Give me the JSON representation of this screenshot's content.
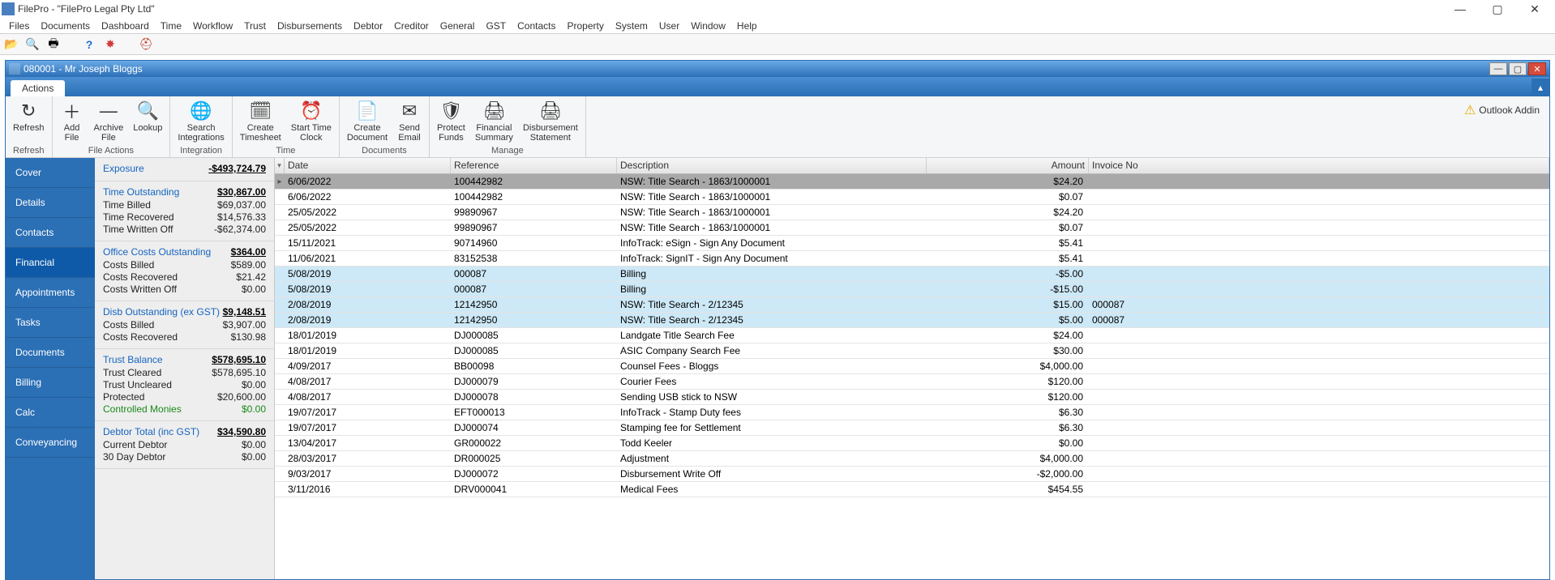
{
  "app": {
    "title": "FilePro - \"FilePro Legal Pty Ltd\""
  },
  "menu": [
    "Files",
    "Documents",
    "Dashboard",
    "Time",
    "Workflow",
    "Trust",
    "Disbursements",
    "Debtor",
    "Creditor",
    "General",
    "GST",
    "Contacts",
    "Property",
    "System",
    "User",
    "Window",
    "Help"
  ],
  "child": {
    "title": "080001 - Mr Joseph Bloggs"
  },
  "tab": {
    "label": "Actions"
  },
  "ribbon": {
    "groups": [
      {
        "label": "Refresh",
        "items": [
          {
            "icon": "↻",
            "label": "Refresh",
            "name": "refresh"
          }
        ]
      },
      {
        "label": "File Actions",
        "items": [
          {
            "icon": "＋",
            "label": "Add\nFile",
            "name": "add-file"
          },
          {
            "icon": "—",
            "label": "Archive\nFile",
            "name": "archive-file"
          },
          {
            "icon": "🔍",
            "label": "Lookup",
            "name": "lookup"
          }
        ]
      },
      {
        "label": "Integration",
        "items": [
          {
            "icon": "🌐",
            "label": "Search\nIntegrations",
            "name": "search-integrations"
          }
        ]
      },
      {
        "label": "Time",
        "items": [
          {
            "icon": "🗓",
            "label": "Create\nTimesheet",
            "name": "create-timesheet"
          },
          {
            "icon": "⏰",
            "label": "Start Time\nClock",
            "name": "start-time-clock"
          }
        ]
      },
      {
        "label": "Documents",
        "items": [
          {
            "icon": "📄",
            "label": "Create\nDocument",
            "name": "create-document"
          },
          {
            "icon": "✉",
            "label": "Send\nEmail",
            "name": "send-email"
          }
        ]
      },
      {
        "label": "Manage",
        "items": [
          {
            "icon": "🛡",
            "label": "Protect\nFunds",
            "name": "protect-funds"
          },
          {
            "icon": "🖨",
            "label": "Financial\nSummary",
            "name": "financial-summary"
          },
          {
            "icon": "🖨",
            "label": "Disbursement\nStatement",
            "name": "disbursement-statement"
          }
        ]
      }
    ],
    "outlook_addin": "Outlook Addin"
  },
  "sidenav": [
    "Cover",
    "Details",
    "Contacts",
    "Financial",
    "Appointments",
    "Tasks",
    "Documents",
    "Billing",
    "Calc",
    "Conveyancing"
  ],
  "sidenav_active": 3,
  "summary": [
    {
      "head": "Exposure",
      "headval": "-$493,724.79",
      "rows": []
    },
    {
      "head": "Time Outstanding",
      "headval": "$30,867.00",
      "rows": [
        {
          "l": "Time Billed",
          "v": "$69,037.00"
        },
        {
          "l": "Time Recovered",
          "v": "$14,576.33"
        },
        {
          "l": "Time Written Off",
          "v": "-$62,374.00"
        }
      ]
    },
    {
      "head": "Office Costs Outstanding",
      "headval": "$364.00",
      "rows": [
        {
          "l": "Costs Billed",
          "v": "$589.00"
        },
        {
          "l": "Costs Recovered",
          "v": "$21.42"
        },
        {
          "l": "Costs Written Off",
          "v": "$0.00"
        }
      ]
    },
    {
      "head": "Disb Outstanding (ex GST)",
      "headval": "$9,148.51",
      "rows": [
        {
          "l": "Costs Billed",
          "v": "$3,907.00"
        },
        {
          "l": "Costs Recovered",
          "v": "$130.98"
        }
      ]
    },
    {
      "head": "Trust Balance",
      "headval": "$578,695.10",
      "rows": [
        {
          "l": "Trust Cleared",
          "v": "$578,695.10"
        },
        {
          "l": "Trust Uncleared",
          "v": "$0.00"
        },
        {
          "l": "Protected",
          "v": "$20,600.00"
        },
        {
          "l": "Controlled Monies",
          "v": "$0.00",
          "green": true
        }
      ]
    },
    {
      "head": "Debtor Total (inc GST)",
      "headval": "$34,590.80",
      "rows": [
        {
          "l": "Current Debtor",
          "v": "$0.00"
        },
        {
          "l": "30 Day Debtor",
          "v": "$0.00"
        }
      ]
    }
  ],
  "grid": {
    "columns": [
      "Date",
      "Reference",
      "Description",
      "Amount",
      "Invoice No"
    ],
    "rows": [
      {
        "sel": true,
        "d": "6/06/2022",
        "r": "100442982",
        "desc": "NSW: Title Search - 1863/1000001",
        "a": "$24.20",
        "i": ""
      },
      {
        "d": "6/06/2022",
        "r": "100442982",
        "desc": "NSW: Title Search - 1863/1000001",
        "a": "$0.07",
        "i": ""
      },
      {
        "d": "25/05/2022",
        "r": "99890967",
        "desc": "NSW: Title Search - 1863/1000001",
        "a": "$24.20",
        "i": ""
      },
      {
        "d": "25/05/2022",
        "r": "99890967",
        "desc": "NSW: Title Search - 1863/1000001",
        "a": "$0.07",
        "i": ""
      },
      {
        "d": "15/11/2021",
        "r": "90714960",
        "desc": "InfoTrack: eSign - Sign Any Document",
        "a": "$5.41",
        "i": ""
      },
      {
        "d": "11/06/2021",
        "r": "83152538",
        "desc": "InfoTrack: SignIT - Sign Any Document",
        "a": "$5.41",
        "i": ""
      },
      {
        "blue": true,
        "d": "5/08/2019",
        "r": "000087",
        "desc": "Billing",
        "a": "-$5.00",
        "i": ""
      },
      {
        "blue": true,
        "d": "5/08/2019",
        "r": "000087",
        "desc": "Billing",
        "a": "-$15.00",
        "i": ""
      },
      {
        "blue": true,
        "d": "2/08/2019",
        "r": "12142950",
        "desc": "NSW: Title Search - 2/12345",
        "a": "$15.00",
        "i": "000087"
      },
      {
        "blue": true,
        "d": "2/08/2019",
        "r": "12142950",
        "desc": "NSW: Title Search - 2/12345",
        "a": "$5.00",
        "i": "000087"
      },
      {
        "d": "18/01/2019",
        "r": "DJ000085",
        "desc": "Landgate Title Search Fee",
        "a": "$24.00",
        "i": ""
      },
      {
        "d": "18/01/2019",
        "r": "DJ000085",
        "desc": "ASIC Company Search Fee",
        "a": "$30.00",
        "i": ""
      },
      {
        "d": "4/09/2017",
        "r": "BB00098",
        "desc": "Counsel Fees - Bloggs",
        "a": "$4,000.00",
        "i": ""
      },
      {
        "d": "4/08/2017",
        "r": "DJ000079",
        "desc": "Courier Fees",
        "a": "$120.00",
        "i": ""
      },
      {
        "d": "4/08/2017",
        "r": "DJ000078",
        "desc": "Sending USB stick to NSW",
        "a": "$120.00",
        "i": ""
      },
      {
        "d": "19/07/2017",
        "r": "EFT000013",
        "desc": "InfoTrack - Stamp Duty fees",
        "a": "$6.30",
        "i": ""
      },
      {
        "d": "19/07/2017",
        "r": "DJ000074",
        "desc": "Stamping fee for Settlement",
        "a": "$6.30",
        "i": ""
      },
      {
        "d": "13/04/2017",
        "r": "GR000022",
        "desc": "Todd Keeler",
        "a": "$0.00",
        "i": ""
      },
      {
        "d": "28/03/2017",
        "r": "DR000025",
        "desc": "Adjustment",
        "a": "$4,000.00",
        "i": ""
      },
      {
        "d": "9/03/2017",
        "r": "DJ000072",
        "desc": "Disbursement Write Off",
        "a": "-$2,000.00",
        "i": ""
      },
      {
        "d": "3/11/2016",
        "r": "DRV000041",
        "desc": "Medical Fees",
        "a": "$454.55",
        "i": ""
      }
    ]
  }
}
